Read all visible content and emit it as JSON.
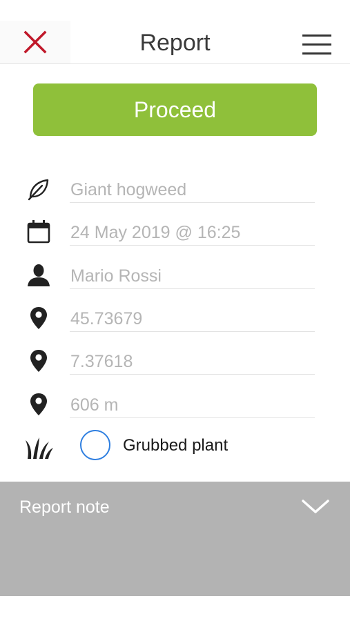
{
  "header": {
    "title": "Report",
    "close_icon": "close-icon",
    "menu_icon": "hamburger-menu-icon"
  },
  "proceed": {
    "label": "Proceed"
  },
  "fields": {
    "species": {
      "icon": "leaf-icon",
      "value": "Giant hogweed"
    },
    "datetime": {
      "icon": "calendar-icon",
      "value": "24 May 2019 @ 16:25"
    },
    "observer": {
      "icon": "user-icon",
      "value": "Mario Rossi"
    },
    "latitude": {
      "icon": "location-pin-icon",
      "value": "45.73679"
    },
    "longitude": {
      "icon": "location-pin-icon",
      "value": "7.37618"
    },
    "altitude": {
      "icon": "location-pin-icon",
      "value": "606 m"
    }
  },
  "grubbed": {
    "icon": "grass-icon",
    "label": "Grubbed plant",
    "checked": false
  },
  "note": {
    "title": "Report note",
    "chevron_icon": "chevron-down-icon"
  },
  "colors": {
    "accent_red": "#c0182a",
    "proceed_green": "#8fc03a",
    "radio_blue": "#2f7fe0",
    "note_bg": "#b3b3b3"
  }
}
